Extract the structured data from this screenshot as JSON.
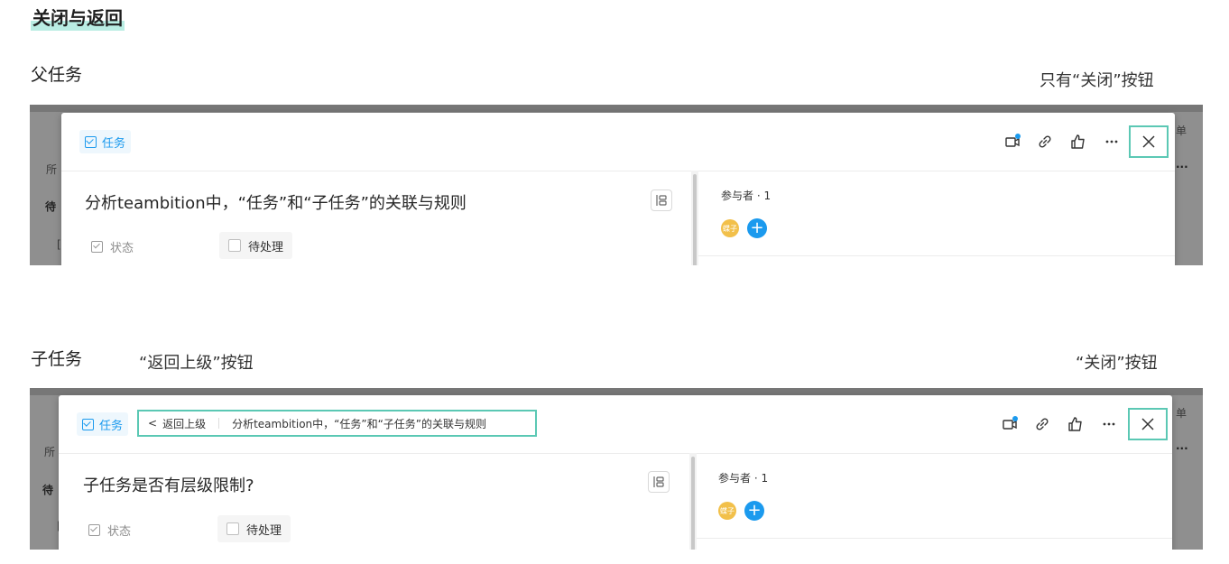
{
  "section_title": "关闭与返回",
  "parent": {
    "heading": "父任务",
    "note": "只有“关闭”按钮",
    "bg": {
      "left_frag_1": "所",
      "left_frag_2": "待",
      "left_frag_3": "[",
      "right_frag_1": "单",
      "right_frag_2": "···"
    },
    "badge": "任务",
    "title": "分析teambition中，“任务”和“子任务”的关联与规则",
    "status_label": "状态",
    "status_value": "待处理",
    "participants_label": "参与者 · 1",
    "avatar_text": "蝶子",
    "add_symbol": "+"
  },
  "child": {
    "heading": "子任务",
    "back_note": "“返回上级”按钮",
    "close_note": "“关闭”按钮",
    "bg": {
      "left_frag_1": "所",
      "left_frag_2": "待",
      "left_frag_3": "[",
      "right_frag_1": "单",
      "right_frag_2": "···"
    },
    "badge": "任务",
    "back_label": "返回上级",
    "back_symbol": "<",
    "breadcrumb_parent": "分析teambition中，“任务”和“子任务”的关联与规则",
    "title": "子任务是否有层级限制?",
    "status_label": "状态",
    "status_value": "待处理",
    "participants_label": "参与者 · 1",
    "avatar_text": "蝶子",
    "add_symbol": "+"
  },
  "icons": [
    "video-icon",
    "link-icon",
    "thumbs-up-icon",
    "more-icon",
    "close-icon",
    "task-checkbox-icon",
    "layout-icon",
    "status-check-icon",
    "chevron-left-icon",
    "add-icon"
  ],
  "colors": {
    "accent": "#1b9aee",
    "highlight_box": "#5bc8b4",
    "title_highlight": "#b9ede3",
    "avatar": "#f2c04a"
  }
}
